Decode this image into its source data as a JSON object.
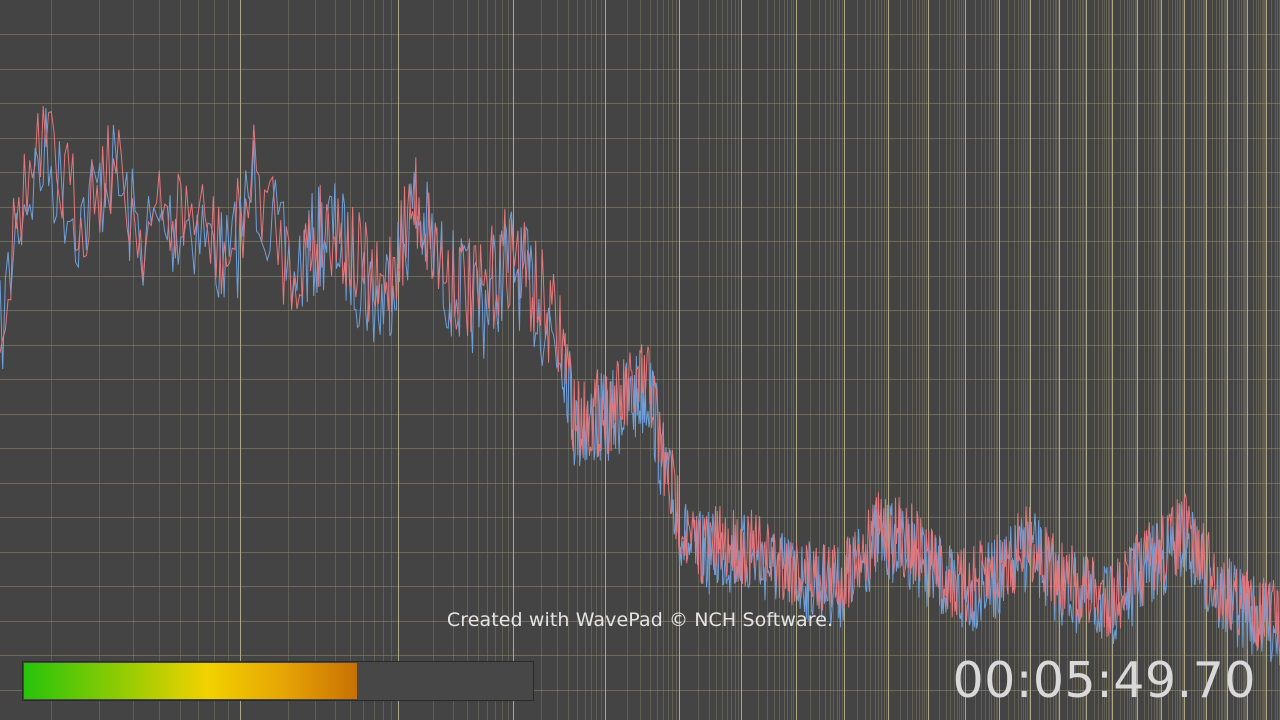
{
  "visualization": {
    "type": "spectrum-analyzer",
    "background_color": "#444444",
    "grid_color": "#8f8a6d",
    "major_grid_color": "#b6ae8c",
    "channel_colors": {
      "left": "#e2777c",
      "right": "#6f9fd8"
    }
  },
  "watermark": {
    "text": "Created with WavePad © NCH Software."
  },
  "level_meter": {
    "level": 0.655
  },
  "playback": {
    "time": "00:05:49.70"
  }
}
